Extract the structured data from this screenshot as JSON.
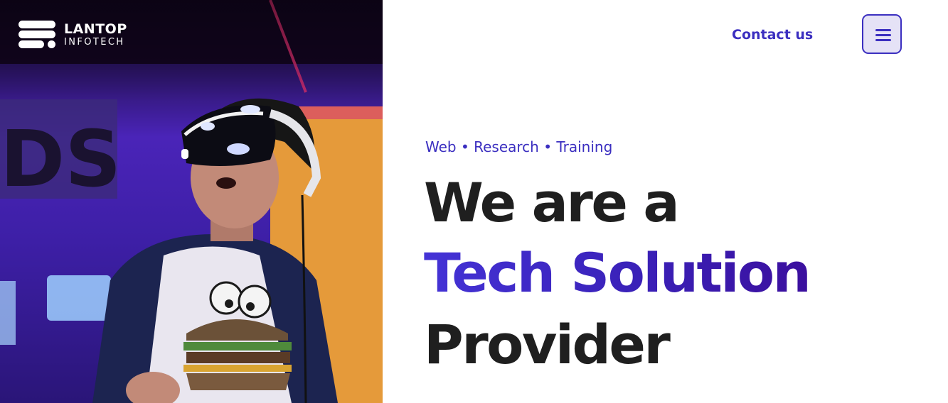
{
  "brand": {
    "name": "LANTOP",
    "subtitle": "INFOTECH",
    "logo_icon": "stacked-bars-logo-icon"
  },
  "header": {
    "contact_label": "Contact us",
    "menu_icon": "hamburger-menu-icon"
  },
  "hero": {
    "tagline": "Web • Research • Training",
    "headline_line1": "We are a",
    "headline_line2": "Tech Solution",
    "headline_line3": "Provider",
    "photo_subject": "person wearing VR headset"
  },
  "colors": {
    "accent": "#3b2fc0",
    "headline_dark": "#1f1f1f",
    "gradient_start": "#4433d6",
    "gradient_end": "#3b0f9e",
    "menu_bg": "#e5e2f6"
  }
}
